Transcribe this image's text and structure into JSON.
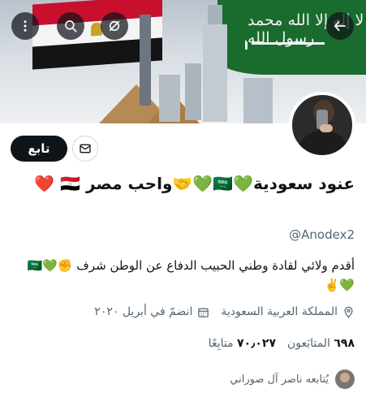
{
  "header": {
    "banner_flag_text": "لا إله إلا الله محمد رسول الله",
    "buttons": {
      "menu_icon": "more-vertical-icon",
      "search_icon": "search-icon",
      "hide_icon": "eye-off-icon",
      "back_icon": "arrow-left-icon"
    }
  },
  "profile": {
    "follow_label": "تابع",
    "display_name": "عنود سعودية💚🇸🇦💚🤝واحب مصر 🇪🇬 ❤️",
    "handle": "@Anodex2",
    "bio": "أقدم ولائي لقادة وطني الحبيب   الدفاع عن الوطن شرف ✊💚🇸🇦 💚✌️",
    "location": "المملكة العربية السعودية",
    "joined": "انضمّ في أبريل ٢٠٢٠",
    "following_count": "٦٩٨",
    "following_label": "المتابَعون",
    "followers_count": "٧٠٫٠٢٧",
    "followers_label": "متابِعًا",
    "followed_by": "يُتابعه ناصر آل صوراني"
  },
  "colors": {
    "text_primary": "#0f1419",
    "text_secondary": "#536471",
    "button_dark": "#0f1419",
    "saudi_green": "#1a6b2e",
    "egypt_red": "#c8102e"
  }
}
